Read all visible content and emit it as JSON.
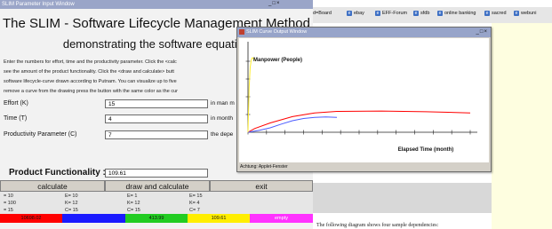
{
  "main_window": {
    "title": "SLIM Parameter Input Window",
    "heading": "The SLIM - Software Lifecycle Management Method",
    "subheading": "demonstrating the software equation",
    "instructions": [
      "Enter the numbers for effort, time and the productivity parameter. Click the <calc",
      "see the amount of the product functionality. Click the <draw and calculate> butt",
      "software lifecycle-curve drawn according to Putnam. You can visualize up to five",
      "remove a curve from the drawing press the button with the same color as the cur"
    ],
    "fields": [
      {
        "label": "Effort (K)",
        "value": "15",
        "unit": "in man m"
      },
      {
        "label": "Time (T)",
        "value": "4",
        "unit": "in month"
      },
      {
        "label": "Productivity Parameter (C)",
        "value": "7",
        "unit": "the depe"
      }
    ],
    "product": {
      "label": "Product Functionality :",
      "value": "109.61"
    },
    "buttons": {
      "calculate": "calculate",
      "draw": "draw and calculate",
      "exit": "exit"
    },
    "dependencies": [
      [
        "= 10",
        "E= 10",
        "E= 1",
        "E= 15"
      ],
      [
        "= 100",
        "K= 12",
        "K= 12",
        "K= 4"
      ],
      [
        "= 15",
        "C= 15",
        "C= 15",
        "C= 7"
      ]
    ],
    "curve_buttons": [
      {
        "label": "10698.02",
        "color": "#ff0000"
      },
      {
        "label": "",
        "color": "#1a1aff"
      },
      {
        "label": "413.99",
        "color": "#22cc22"
      },
      {
        "label": "109.61",
        "color": "#ffee00"
      },
      {
        "label": "empty",
        "color": "#ff33ff"
      }
    ]
  },
  "browser": {
    "bookmarks": [
      "d=Board",
      "ebay",
      "EFF-Forum",
      "sfdb",
      "online banking",
      "sacred",
      "webuni"
    ],
    "bottom_text": "The following diagram shows four sample dependencies:"
  },
  "curve_window": {
    "title": "SLIM Curve Output Window",
    "status": "Achtung: Applet-Fenster"
  },
  "chart_data": {
    "type": "line",
    "xlabel": "Elapsed Time (month)",
    "ylabel": "Manpower (People)",
    "grid": false,
    "series": [
      {
        "color": "#ff0000",
        "x": [
          0.0,
          0.3,
          1.0,
          2.0,
          3.0,
          4.0,
          6.0,
          8.0,
          10.0
        ],
        "y": [
          0.0,
          0.1,
          0.25,
          0.42,
          0.52,
          0.56,
          0.57,
          0.55,
          0.52
        ]
      },
      {
        "color": "#4c5cff",
        "x": [
          0.0,
          0.5,
          1.0,
          1.5,
          2.0,
          2.5,
          3.0,
          3.5,
          4.0
        ],
        "y": [
          0.0,
          0.05,
          0.12,
          0.22,
          0.31,
          0.37,
          0.4,
          0.41,
          0.4
        ]
      },
      {
        "color": "#ffee33",
        "x": [
          0.0,
          0.05,
          0.1,
          0.15,
          0.2,
          0.25,
          0.3
        ],
        "y": [
          0.0,
          1.2,
          1.75,
          1.95,
          2.0,
          1.97,
          1.92
        ]
      }
    ],
    "x_ticks": 13
  }
}
